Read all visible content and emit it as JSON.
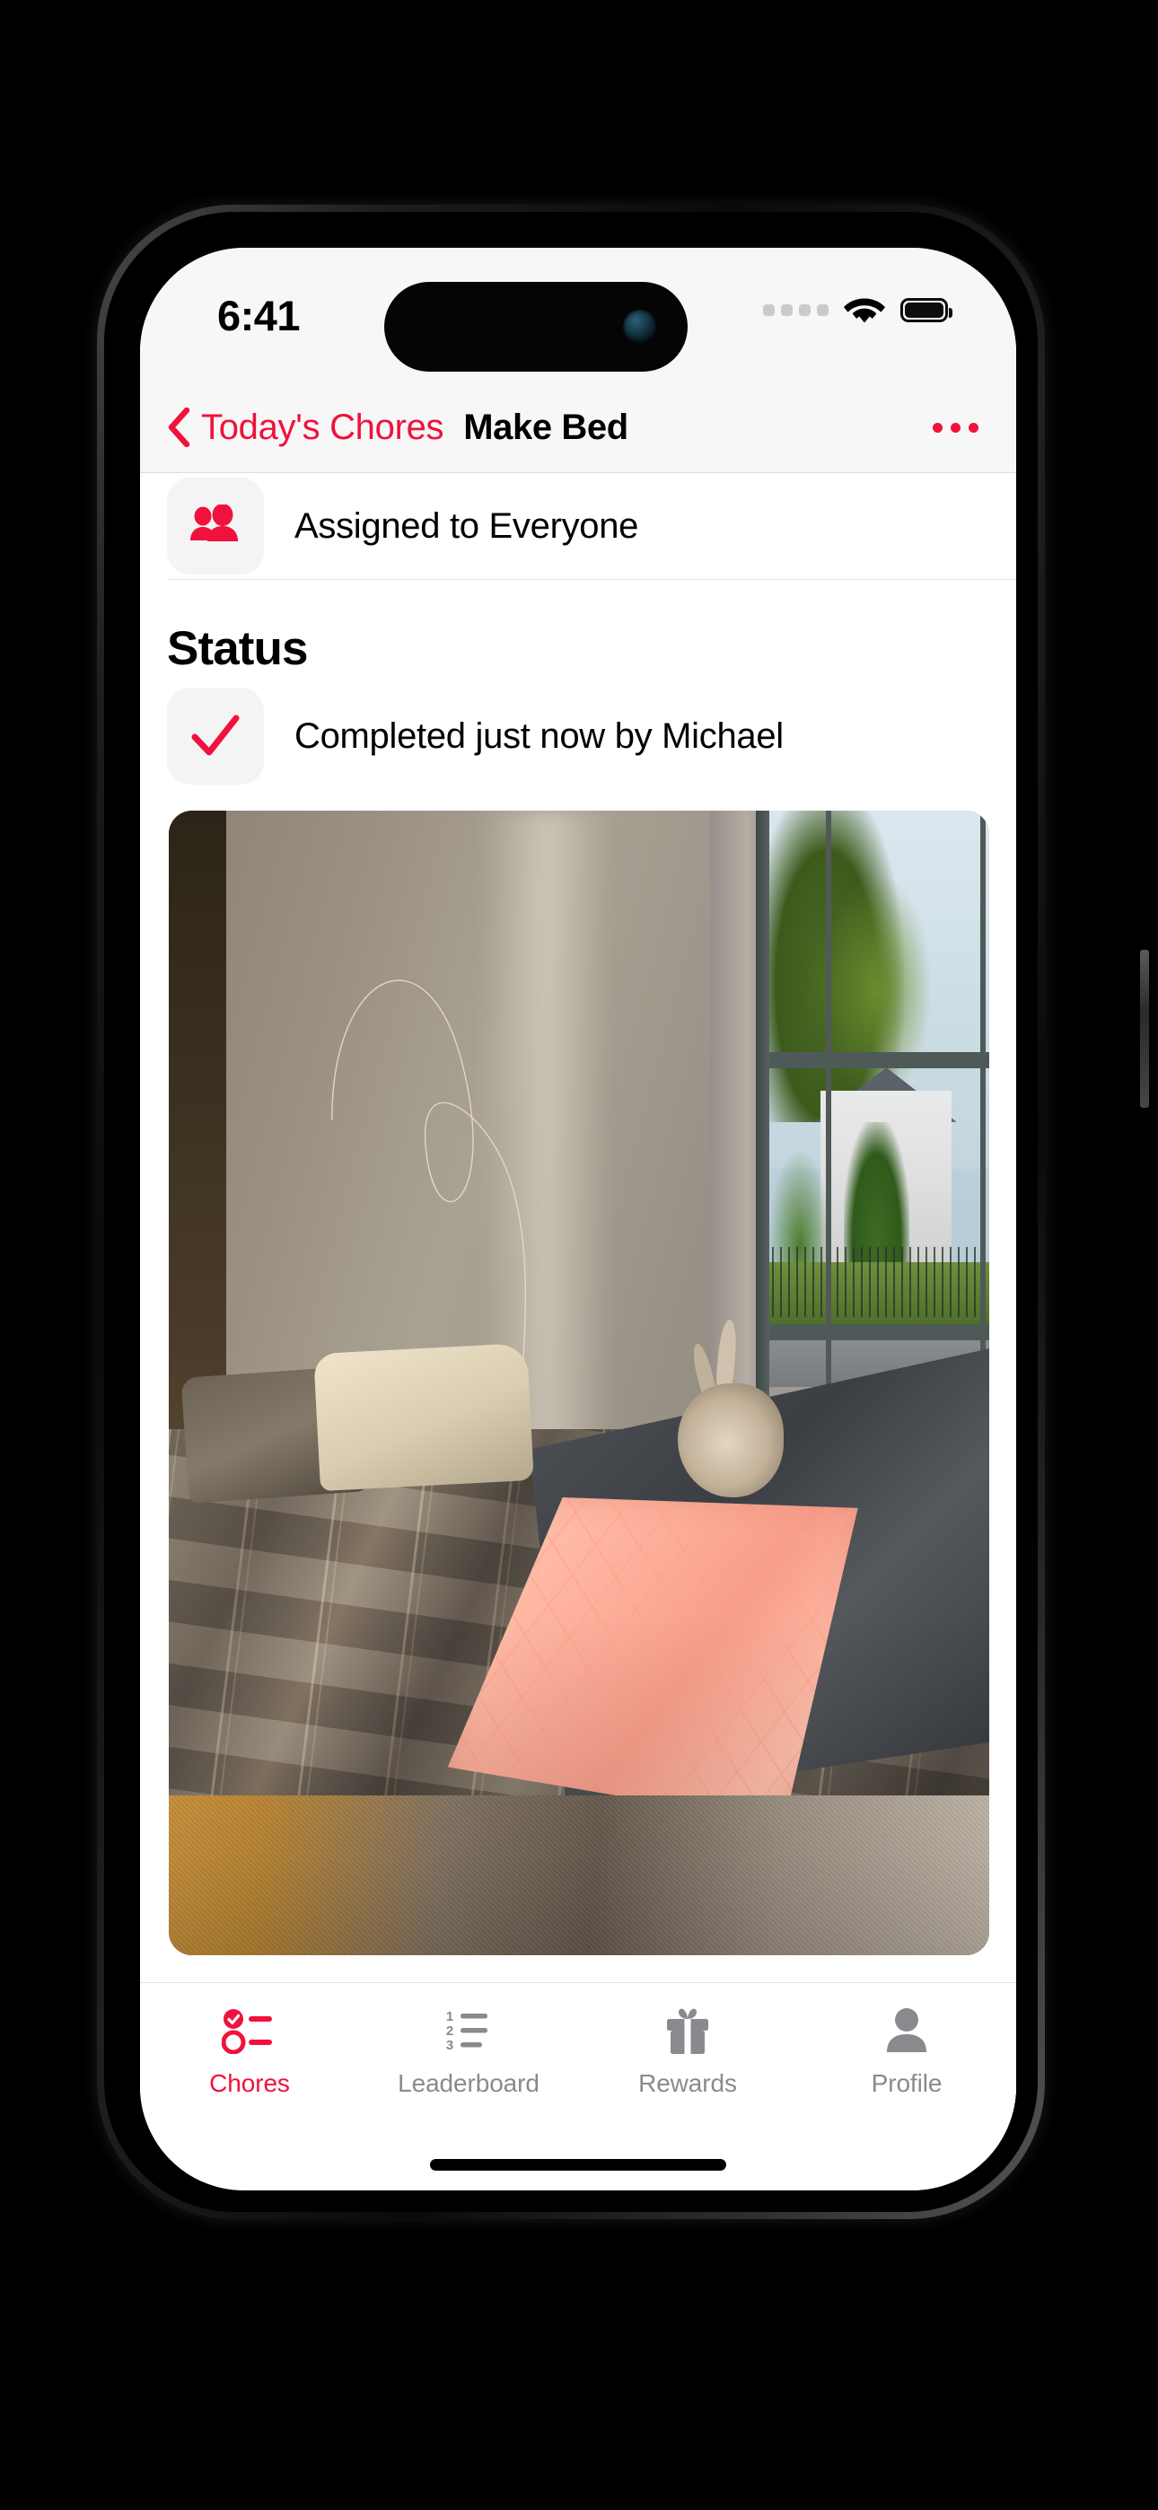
{
  "theme": {
    "accent_red": "#F0123C",
    "inactive_gray": "#8A8A8E",
    "tile_gray": "#F4F4F4",
    "bar_background": "#F7F7F7"
  },
  "status_bar": {
    "time": "6:41",
    "cellular_icon": "cellular-dots-icon",
    "wifi_icon": "wifi-icon",
    "battery_icon": "battery-full-icon",
    "battery_level": 100
  },
  "nav_bar": {
    "back_label": "Today's Chores",
    "back_icon": "chevron-left-icon",
    "title": "Make Bed",
    "more_icon": "ellipsis-icon"
  },
  "detail": {
    "assignment_row": {
      "icon": "people-two-icon",
      "label": "Assigned to Everyone"
    },
    "section_title": "Status",
    "status_row": {
      "icon": "checkmark-icon",
      "label": "Completed just now by Michael"
    },
    "photo": {
      "alt": "Photo of a made bed with plaid comforter, pink blanket and a rabbit, beside a sunlit window"
    }
  },
  "tab_bar": {
    "items": [
      {
        "label": "Chores",
        "icon": "checklist-icon",
        "active": true
      },
      {
        "label": "Leaderboard",
        "icon": "ranked-list-icon",
        "active": false
      },
      {
        "label": "Rewards",
        "icon": "gift-icon",
        "active": false
      },
      {
        "label": "Profile",
        "icon": "person-icon",
        "active": false
      }
    ]
  },
  "system": {
    "home_indicator": "home-indicator"
  }
}
